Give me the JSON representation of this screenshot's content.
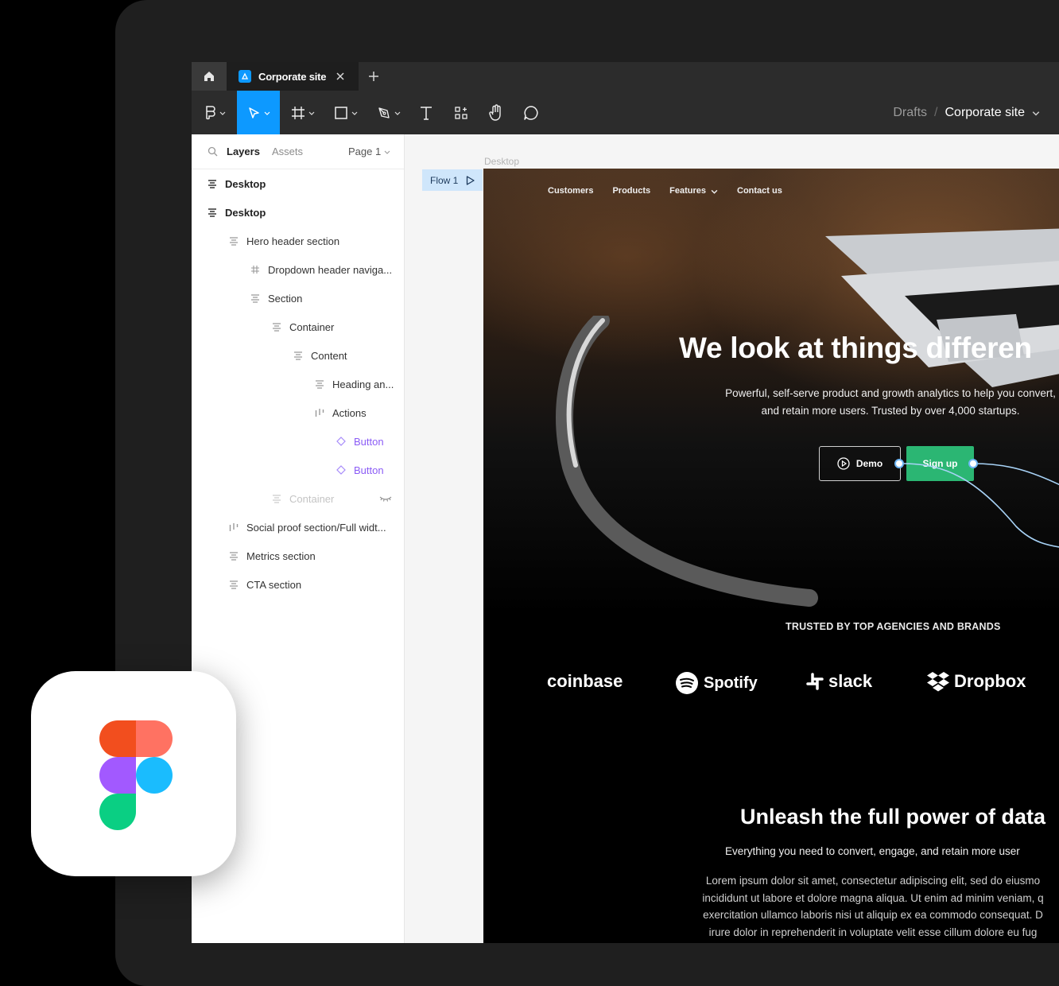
{
  "tabs": {
    "active_label": "Corporate site"
  },
  "toolbar": {
    "breadcrumb_drafts": "Drafts",
    "breadcrumb_sep": "/",
    "breadcrumb_file": "Corporate site"
  },
  "panel": {
    "layers_tab": "Layers",
    "assets_tab": "Assets",
    "page_label": "Page 1"
  },
  "layers": [
    {
      "label": "Desktop"
    },
    {
      "label": "Desktop"
    },
    {
      "label": "Hero header section"
    },
    {
      "label": "Dropdown header naviga..."
    },
    {
      "label": "Section"
    },
    {
      "label": "Container"
    },
    {
      "label": "Content"
    },
    {
      "label": "Heading an..."
    },
    {
      "label": "Actions"
    },
    {
      "label": "Button"
    },
    {
      "label": "Button"
    },
    {
      "label": "Container"
    },
    {
      "label": "Social proof section/Full widt..."
    },
    {
      "label": "Metrics section"
    },
    {
      "label": "CTA section"
    }
  ],
  "canvas": {
    "frame_label": "Desktop",
    "flow_label": "Flow 1"
  },
  "site": {
    "nav": [
      "Customers",
      "Products",
      "Features",
      "Contact us"
    ],
    "hero_title": "We look at things differen",
    "hero_sub_1": "Powerful, self-serve product and growth analytics to help you convert,",
    "hero_sub_2": "and retain more users. Trusted by over 4,000 startups.",
    "demo_label": "Demo",
    "signup_label": "Sign up",
    "trusted": "TRUSTED BY TOP AGENCIES AND BRANDS",
    "logos": [
      "coinbase",
      "Spotify",
      "slack",
      "Dropbox"
    ],
    "section_title": "Unleash the full power of data",
    "section_sub": "Everything you need to convert, engage, and retain more user",
    "lorem": [
      "Lorem ipsum dolor sit amet, consectetur adipiscing elit, sed do eiusmo",
      "incididunt ut labore et dolore magna aliqua. Ut enim ad minim veniam, q",
      "exercitation ullamco laboris nisi ut aliquip ex ea commodo consequat. D",
      "irure dolor in reprehenderit in voluptate velit esse cillum dolore eu fug"
    ]
  },
  "colors": {
    "accent": "#0d99ff",
    "signup": "#2bb673",
    "component": "#8b5cf6"
  },
  "icons": [
    "home-icon",
    "figma-file-icon",
    "close-icon",
    "plus-icon",
    "figma-menu-icon",
    "move-tool-icon",
    "frame-tool-icon",
    "rectangle-tool-icon",
    "pen-tool-icon",
    "text-tool-icon",
    "resources-icon",
    "hand-tool-icon",
    "comment-icon",
    "search-icon",
    "play-icon",
    "figma-logo"
  ]
}
